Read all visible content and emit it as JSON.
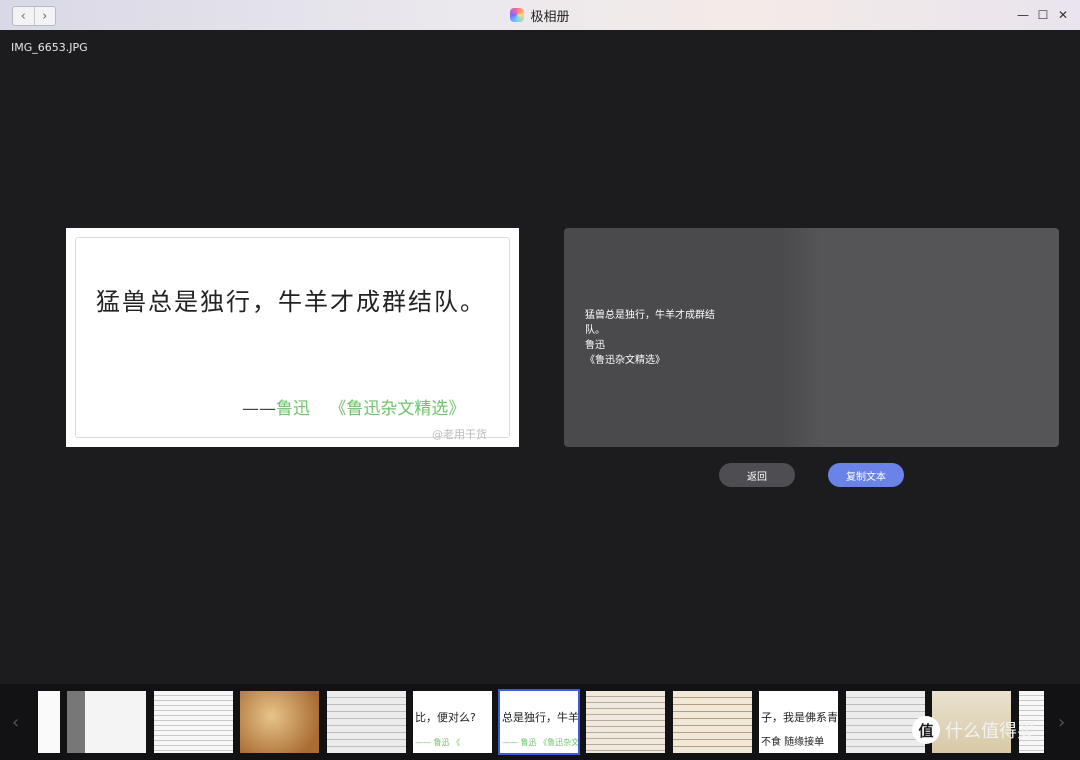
{
  "window": {
    "title": "极相册",
    "back_glyph": "‹",
    "forward_glyph": "›",
    "minimize_glyph": "—",
    "maximize_glyph": "☐",
    "close_glyph": "✕"
  },
  "image": {
    "filename": "IMG_6653.JPG",
    "quote": "猛兽总是独行，牛羊才成群结队。",
    "attribution_dash": "——",
    "attribution_author": "鲁迅",
    "attribution_book": "《鲁迅杂文精选》",
    "watermark": "@老用干货"
  },
  "ocr": {
    "text": "猛兽总是独行，牛羊才成群结\n队。\n鲁迅\n《鲁迅杂文精选》"
  },
  "actions": {
    "back_label": "返回",
    "copy_label": "复制文本"
  },
  "filmstrip": {
    "prev_glyph": "‹",
    "next_glyph": "›",
    "thumb_texts": {
      "t6": "比，便对么?",
      "t6_sub": "—— 鲁迅 《",
      "t7": "总是独行，牛羊才成",
      "t7_sub": "—— 鲁迅 《鲁迅杂文",
      "t10": "子，我是佛系青",
      "t10_sub": "不食  随缘接单"
    }
  },
  "watermark_brand": {
    "badge": "值",
    "text": "什么值得买"
  }
}
